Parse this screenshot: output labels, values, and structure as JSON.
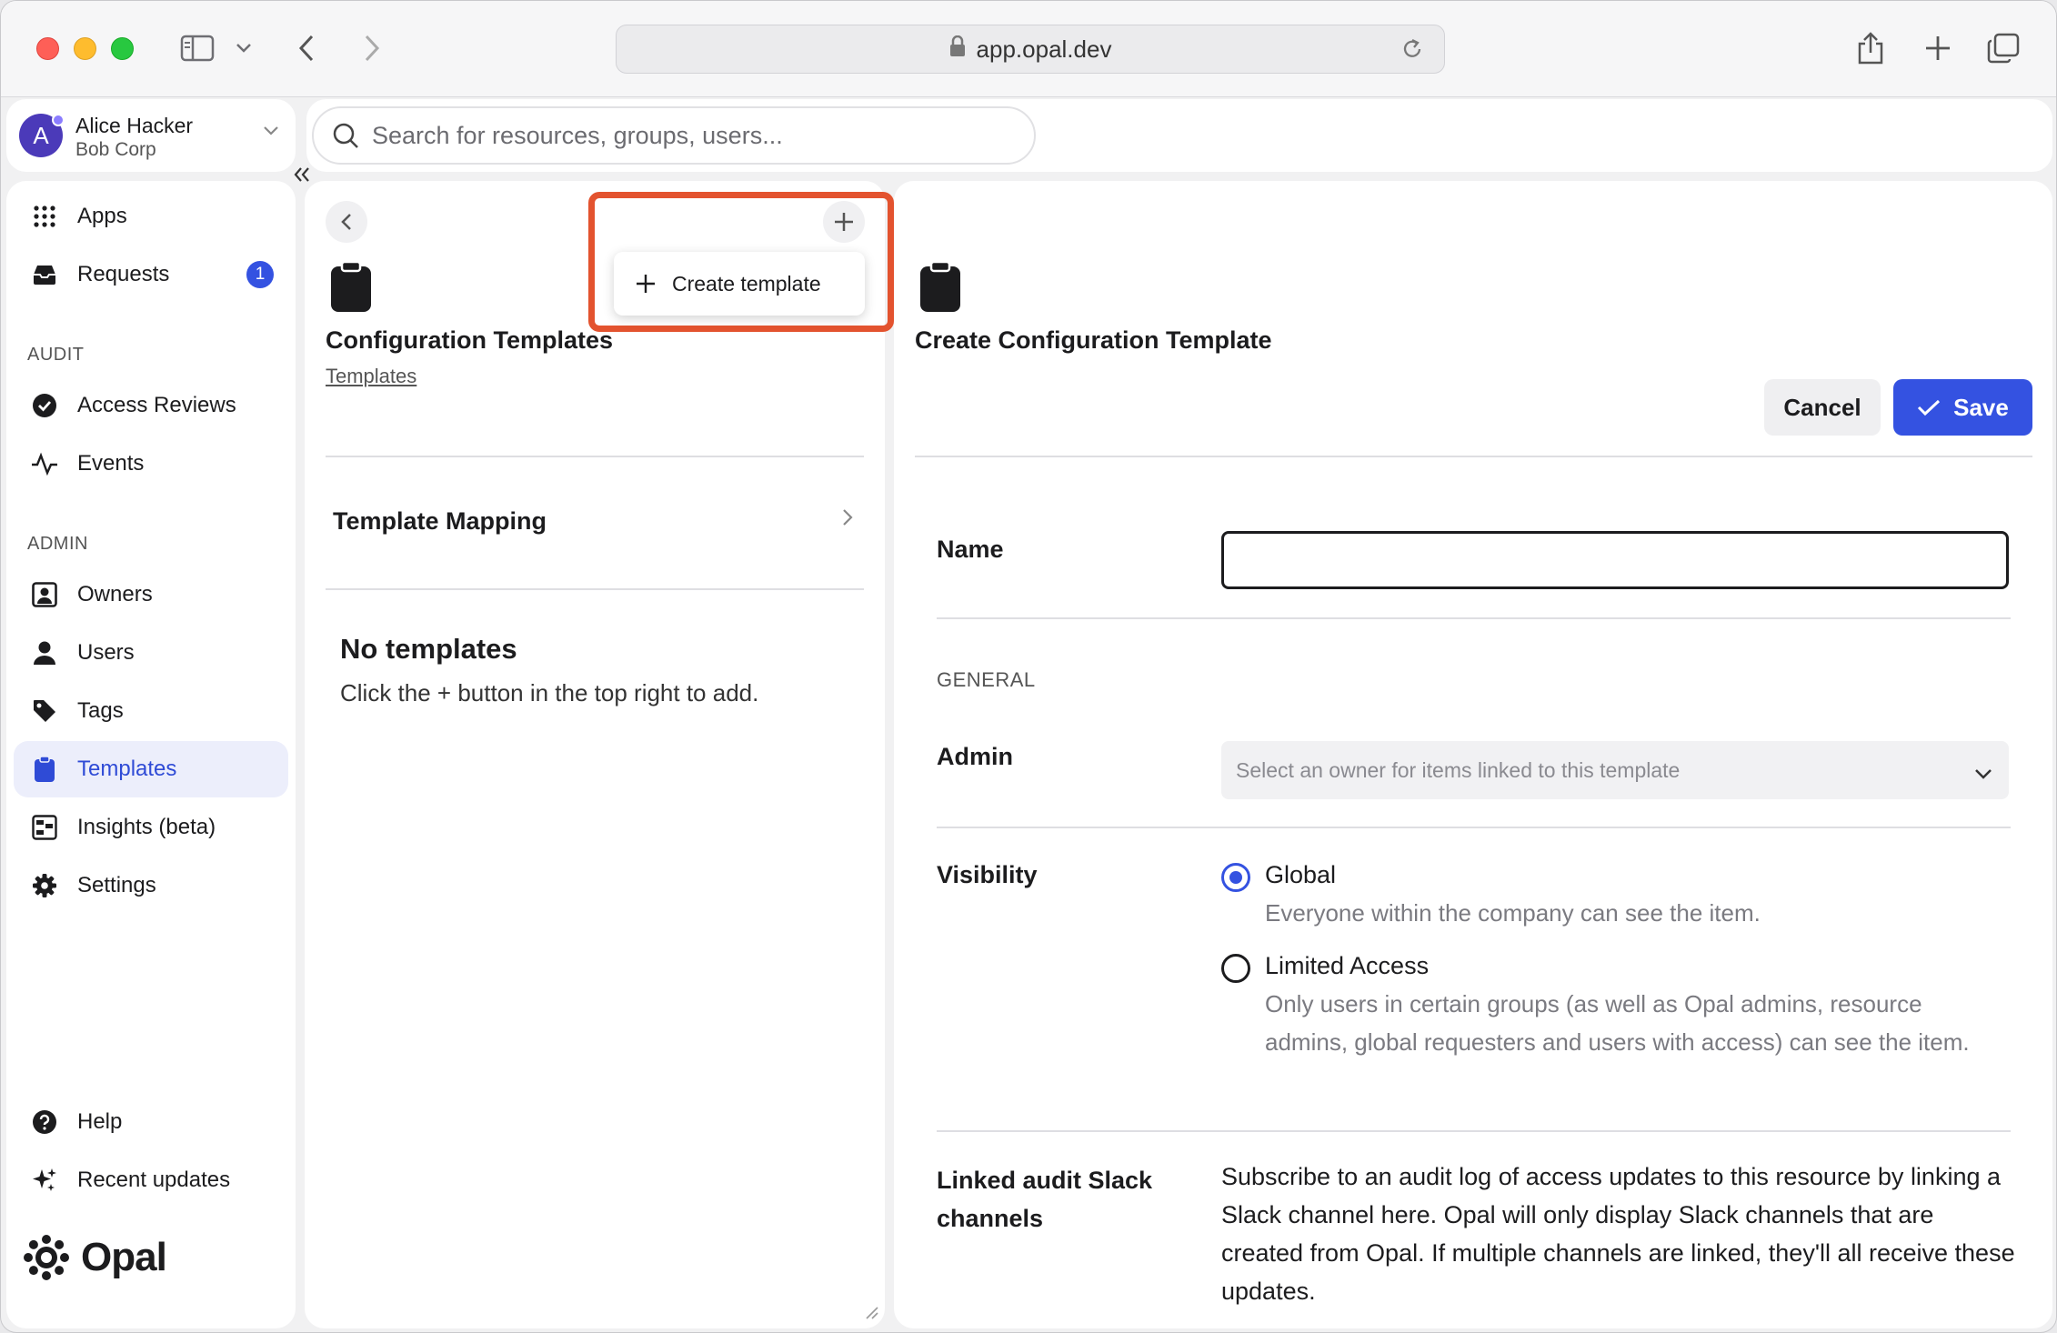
{
  "browser": {
    "url": "app.opal.dev"
  },
  "account": {
    "avatar_letter": "A",
    "name": "Alice Hacker",
    "org": "Bob Corp"
  },
  "search": {
    "placeholder": "Search for resources, groups, users..."
  },
  "sidebar": {
    "items_top": [
      {
        "label": "Apps",
        "icon": "grid-icon"
      },
      {
        "label": "Requests",
        "icon": "inbox-icon",
        "badge": "1"
      }
    ],
    "audit_label": "AUDIT",
    "audit_items": [
      {
        "label": "Access Reviews",
        "icon": "check-circle-icon"
      },
      {
        "label": "Events",
        "icon": "activity-icon"
      }
    ],
    "admin_label": "ADMIN",
    "admin_items": [
      {
        "label": "Owners",
        "icon": "owner-icon"
      },
      {
        "label": "Users",
        "icon": "user-icon"
      },
      {
        "label": "Tags",
        "icon": "tag-icon"
      },
      {
        "label": "Templates",
        "icon": "clipboard-icon",
        "active": true
      },
      {
        "label": "Insights (beta)",
        "icon": "insights-icon"
      },
      {
        "label": "Settings",
        "icon": "gear-icon"
      }
    ],
    "bottom_items": [
      {
        "label": "Help",
        "icon": "help-icon"
      },
      {
        "label": "Recent updates",
        "icon": "sparkle-icon"
      }
    ],
    "logo_text": "Opal"
  },
  "middle": {
    "title": "Configuration Templates",
    "breadcrumb": "Templates",
    "popover_label": "Create template",
    "mapping_label": "Template Mapping",
    "empty_title": "No templates",
    "empty_subtitle": "Click the + button in the top right to add."
  },
  "form": {
    "title": "Create Configuration Template",
    "cancel_label": "Cancel",
    "save_label": "Save",
    "name_label": "Name",
    "name_value": "",
    "general_label": "GENERAL",
    "admin_label": "Admin",
    "admin_placeholder": "Select an owner for items linked to this template",
    "visibility_label": "Visibility",
    "visibility_options": [
      {
        "label": "Global",
        "description": "Everyone within the company can see the item.",
        "selected": true
      },
      {
        "label": "Limited Access",
        "description": "Only users in certain groups (as well as Opal admins, resource admins, global requesters and users with access) can see the item.",
        "selected": false
      }
    ],
    "slack_label": "Linked audit Slack channels",
    "slack_description": "Subscribe to an audit log of access updates to this resource by linking a Slack channel here. Opal will only display Slack channels that are created from Opal. If multiple channels are linked, they'll all receive these updates."
  },
  "colors": {
    "accent": "#3452e1",
    "highlight": "#e3532f",
    "active_bg": "#eceefb"
  }
}
